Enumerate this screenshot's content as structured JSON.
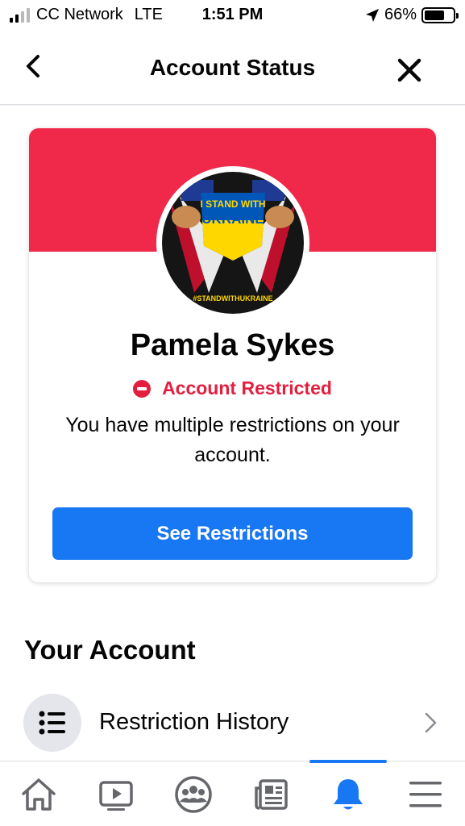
{
  "status_bar": {
    "carrier": "CC Network",
    "network": "LTE",
    "time": "1:51 PM",
    "battery": "66%"
  },
  "header": {
    "title": "Account Status",
    "back_icon": "chevron-left-icon",
    "close_icon": "close-icon"
  },
  "account_card": {
    "banner_color": "#f02849",
    "avatar_text_top": "I STAND WITH",
    "avatar_text_main": "UKRAINE",
    "avatar_hashtag": "#STANDWITHUKRAINE",
    "name": "Pamela Sykes",
    "status_icon": "restricted-icon",
    "status": "Account Restricted",
    "status_color": "#e41e3f",
    "description": "You have multiple restrictions on your account.",
    "button_label": "See Restrictions",
    "button_color": "#1877f2"
  },
  "your_account": {
    "title": "Your Account",
    "items": [
      {
        "icon": "list-icon",
        "label": "Restriction History"
      }
    ]
  },
  "tabbar": {
    "active_color": "#1877f2",
    "tabs": [
      {
        "name": "home",
        "icon": "home-icon",
        "active": false
      },
      {
        "name": "watch",
        "icon": "video-icon",
        "active": false
      },
      {
        "name": "groups",
        "icon": "groups-icon",
        "active": false
      },
      {
        "name": "news",
        "icon": "news-icon",
        "active": false
      },
      {
        "name": "notifications",
        "icon": "bell-icon",
        "active": true
      },
      {
        "name": "menu",
        "icon": "menu-icon",
        "active": false
      }
    ]
  }
}
